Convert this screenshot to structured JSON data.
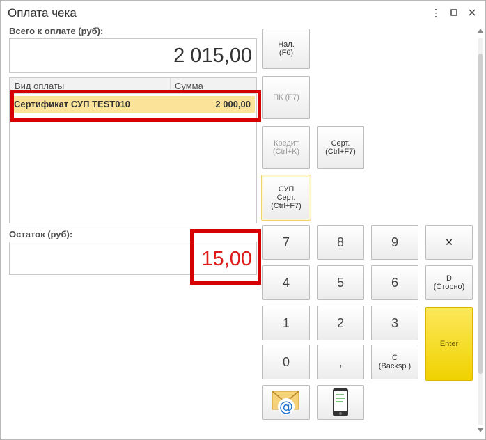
{
  "window": {
    "title": "Оплата чека",
    "menu_icon": "kebab-menu-icon",
    "maximize_icon": "maximize-icon",
    "close_icon": "close-icon"
  },
  "total": {
    "label": "Всего к оплате (руб):",
    "value": "2 015,00"
  },
  "table": {
    "columns": [
      "Вид оплаты",
      "Сумма"
    ],
    "rows": [
      {
        "type": "Сертификат СУП TEST010",
        "amount": "2 000,00"
      }
    ]
  },
  "remainder": {
    "label": "Остаток (руб):",
    "value": "15,00"
  },
  "buttons": {
    "cash": "Нал.\n(F6)",
    "card": "ПК (F7)",
    "credit": "Кредит\n(Ctrl+K)",
    "cert": "Серт.\n(Ctrl+F7)",
    "sup_cert": "СУП\nСерт.\n(Ctrl+F7)",
    "n7": "7",
    "n8": "8",
    "n9": "9",
    "clear_x": "×",
    "n4": "4",
    "n5": "5",
    "n6": "6",
    "storno": "D\n(Сторно)",
    "n1": "1",
    "n2": "2",
    "n3": "3",
    "enter": "Enter",
    "n0": "0",
    "comma": ",",
    "backspace": "C\n(Backsp.)"
  },
  "icons": {
    "email": "email-at-icon",
    "phone": "mobile-phone-icon"
  },
  "colors": {
    "highlight_row": "#fbe49a",
    "remainder": "#e01b1b",
    "annotation": "#d60000",
    "enter": "#f5dc1e"
  }
}
